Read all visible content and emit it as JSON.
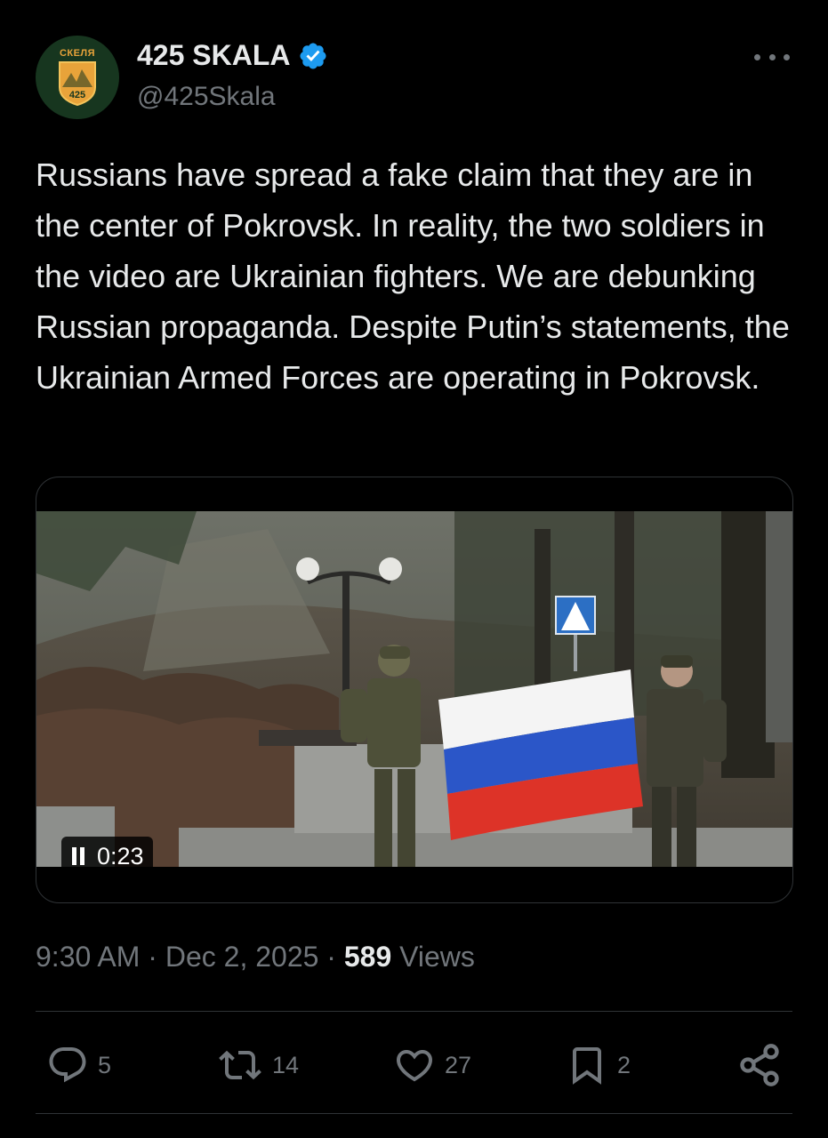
{
  "author": {
    "name": "425 SKALA",
    "handle": "@425Skala",
    "avatar_top_text": "СКЕЛЯ",
    "avatar_number": "425",
    "verified_color": "#1d9bf0"
  },
  "tweet": {
    "text": "Russians have spread a fake claim that they are in the center of Pokrovsk. In reality, the two soldiers in the video are Ukrainian fighters. We are debunking Russian propaganda. Despite Putin’s statements, the Ukrainian Armed Forces are operating in Pokrovsk."
  },
  "video": {
    "elapsed": "0:23",
    "state_icon": "pause-icon"
  },
  "meta": {
    "time": "9:30 AM",
    "separator": "·",
    "date": "Dec 2, 2025",
    "views_count": "589",
    "views_label": "Views"
  },
  "actions": {
    "replies": "5",
    "reposts": "14",
    "likes": "27",
    "bookmarks": "2"
  },
  "colors": {
    "background": "#000000",
    "text": "#e7e9ea",
    "muted": "#71767b",
    "accent": "#1d9bf0"
  }
}
